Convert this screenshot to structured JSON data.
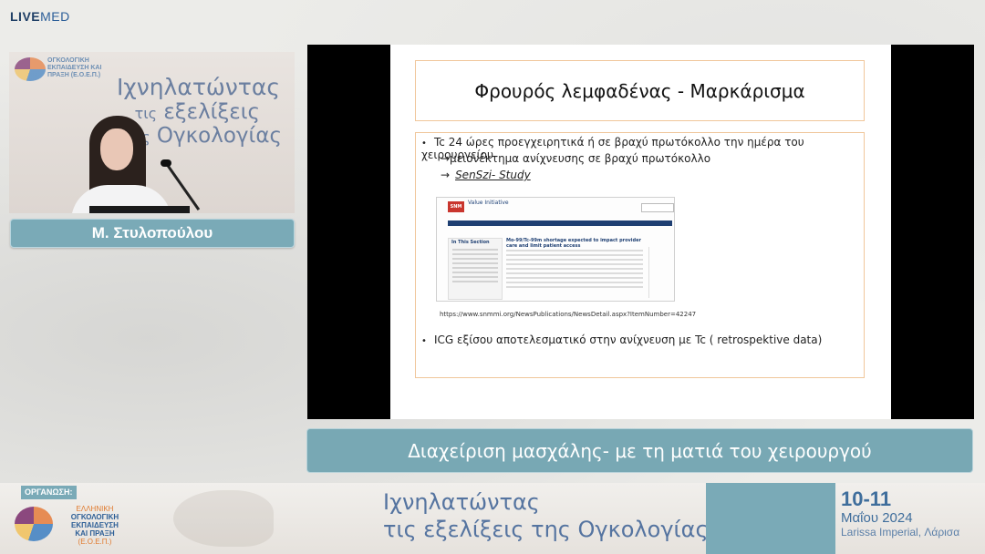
{
  "brand": {
    "live": "LIVE",
    "med": "MED"
  },
  "speaker": {
    "logo_text": "ΟΓΚΟΛΟΓΙΚΗ ΕΚΠΑΙΔΕΥΣΗ ΚΑΙ ΠΡΑΞΗ (Ε.Ο.Ε.Π.)",
    "title_line1": "Ιχνηλατώντας",
    "title_line2_small": "τις",
    "title_line2": "εξελίξεις",
    "title_line3_small": "της",
    "title_line3": "Ογκολογίας",
    "name": "Μ. Στυλοπούλου"
  },
  "slide": {
    "title": "Φρουρός λεμφαδένας - Μαρκάρισμα",
    "bullet1": "Tc 24 ώρες προεγχειρητικά ή σε βραχύ πρωτόκολλο την ημέρα του χειρουργείου",
    "sub1": "→μειονέκτημα ανίχνευσης σε βραχύ πρωτόκολλο",
    "sub2_arrow": "→",
    "sub2_link": "SenSzi- Study",
    "website": {
      "logo": "SNM MI",
      "initiative": "Value Initiative",
      "sidebar_header": "In This Section",
      "headline": "Mo-99/Tc-99m shortage expected to impact provider care and limit patient access"
    },
    "url": "https://www.snmmi.org/NewsPublications/NewsDetail.aspx?ItemNumber=42247",
    "bullet2": "ICG εξίσου αποτελεσματικό στην ανίχνευση με Tc ( retrospektive data)"
  },
  "topic": "Διαχείριση μασχάλης- με τη ματιά του χειρουργού",
  "footer": {
    "org_label": "ΟΡΓΑΝΩΣΗ:",
    "logo_line1": "ΕΛΛΗΝΙΚΗ",
    "logo_line2": "ΟΓΚΟΛΟΓΙΚΗ",
    "logo_line3": "ΕΚΠΑΙΔΕΥΣΗ",
    "logo_line4": "ΚΑΙ ΠΡΑΞΗ",
    "logo_line5": "(Ε.Ο.Ε.Π.)",
    "title_line1": "Ιχνηλατώντας",
    "title_line2": "τις εξελίξεις της Ογκολογίας",
    "dates": "10-11",
    "month": "Μαΐου 2024",
    "place": "Larissa Imperial, Λάρισα"
  }
}
